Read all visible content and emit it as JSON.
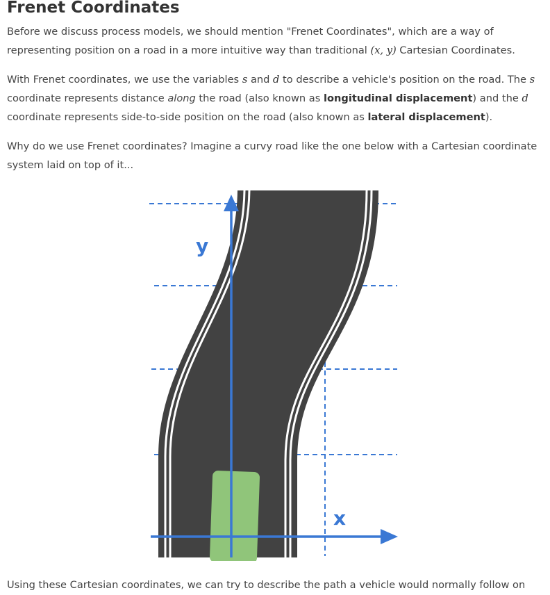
{
  "heading": "Frenet Coordinates",
  "p1": {
    "t1": "Before we discuss process models, we should mention \"Frenet Coordinates\", which are a way of representing position on a road in a more intuitive way than traditional ",
    "math": "(x, y)",
    "t2": " Cartesian Coordinates."
  },
  "p2": {
    "t1": "With Frenet coordinates, we use the variables ",
    "s": "s",
    "t2": " and ",
    "d": "d",
    "t3": " to describe a vehicle's position on the road. The ",
    "t4": " coordinate represents distance ",
    "along": "along",
    "t5": " the road (also known as ",
    "b1": "longitudinal displacement",
    "t6": ") and the ",
    "t7": " coordinate represents side-to-side position on the road (also known as ",
    "b2": "lateral displacement",
    "t8": ")."
  },
  "p3": "Why do we use Frenet coordinates? Imagine a curvy road like the one below with a Cartesian coordinate system laid on top of it...",
  "figure": {
    "y_label": "y",
    "x_label": "x",
    "road_color": "#424242",
    "axis_color": "#3a78d4",
    "car_color": "#90c57a"
  },
  "p4": "Using these Cartesian coordinates, we can try to describe the path a vehicle would normally follow on"
}
